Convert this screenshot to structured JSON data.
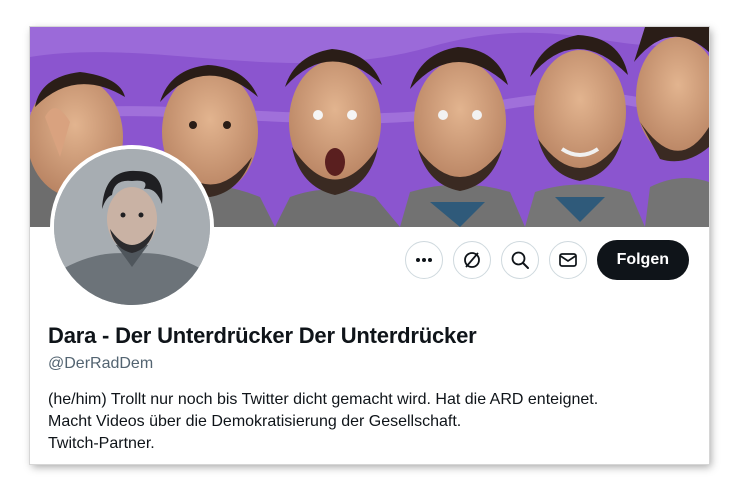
{
  "profile": {
    "display_name": "Dara - Der Unterdrücker Der Unterdrücker",
    "handle": "@DerRadDem",
    "bio_lines": [
      "(he/him) Trollt nur noch bis Twitter dicht gemacht wird. Hat die ARD enteignet.",
      "Macht Videos über die Demokratisierung der Gesellschaft.",
      "Twitch-Partner."
    ]
  },
  "actions": {
    "more_icon": "more-horizontal-icon",
    "subscribe_icon": "subscribe-icon",
    "search_icon": "search-icon",
    "message_icon": "mail-icon",
    "follow_label": "Folgen"
  },
  "colors": {
    "banner_purple": "#8a4fd0",
    "follow_bg": "#0f1419",
    "text_primary": "#0f1419",
    "text_secondary": "#536471",
    "border": "#cfd9de"
  }
}
